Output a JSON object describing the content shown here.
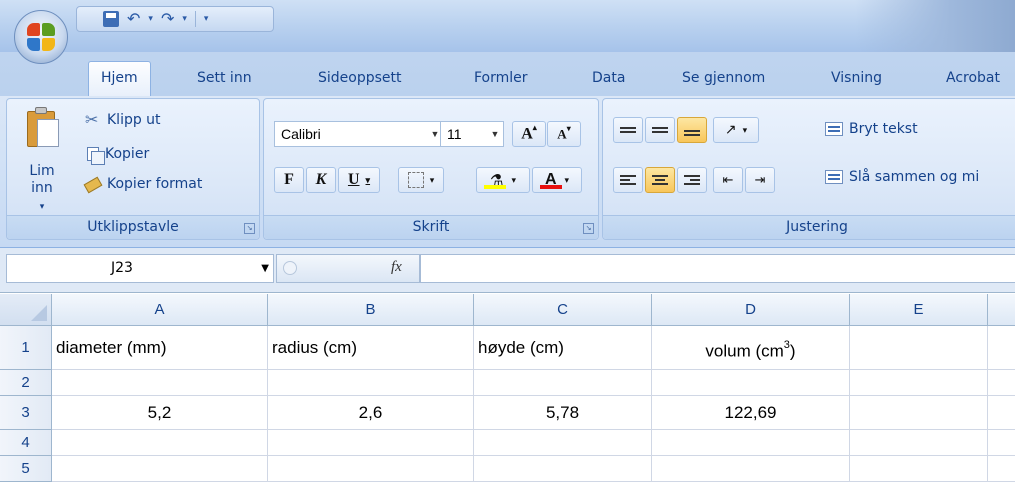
{
  "quick_access": {
    "save": "save",
    "undo": "undo",
    "redo": "redo"
  },
  "tabs": [
    "Hjem",
    "Sett inn",
    "Sideoppsett",
    "Formler",
    "Data",
    "Se gjennom",
    "Visning",
    "Acrobat"
  ],
  "clipboard": {
    "paste_label_1": "Lim",
    "paste_label_2": "inn",
    "cut": "Klipp ut",
    "copy": "Kopier",
    "format_painter": "Kopier format",
    "group_label": "Utklippstavle"
  },
  "font": {
    "name": "Calibri",
    "size": "11",
    "bold": "F",
    "italic": "K",
    "underline": "U",
    "group_label": "Skrift",
    "fill_color": "#ffff00",
    "font_color": "#e81010"
  },
  "alignment": {
    "wrap_text": "Bryt tekst",
    "merge": "Slå sammen og mi",
    "group_label": "Justering"
  },
  "formula_bar": {
    "name_box": "J23",
    "fx": "fx",
    "formula": ""
  },
  "sheet": {
    "columns": [
      "A",
      "B",
      "C",
      "D",
      "E"
    ],
    "rows": [
      "1",
      "2",
      "3",
      "4",
      "5"
    ],
    "row1": {
      "a": "diameter  (mm)",
      "b": "radius  (cm)",
      "c": "høyde (cm)",
      "d_base": "volum (cm",
      "d_sup": "3",
      "d_end": ")"
    },
    "row3": {
      "a": "5,2",
      "b": "2,6",
      "c": "5,78",
      "d": "122,69"
    }
  },
  "colors": {
    "accent": "#15428b",
    "ribbon": "#d2e2f6",
    "highlight": "#f8c65a"
  }
}
